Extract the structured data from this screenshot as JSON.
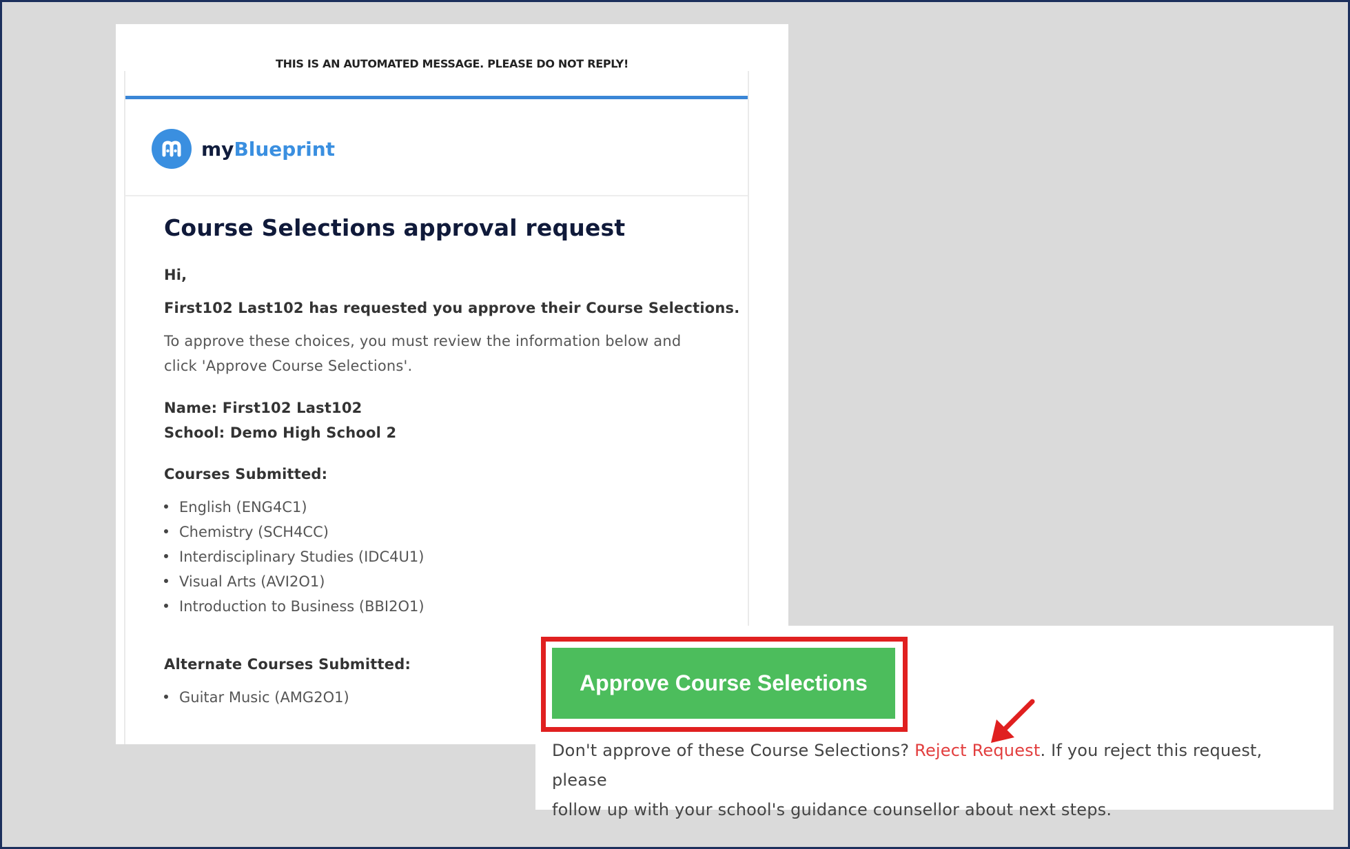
{
  "email": {
    "automated_note": "THIS IS AN AUTOMATED MESSAGE. PLEASE DO NOT REPLY!",
    "brand": {
      "prefix": "my",
      "name": "Blueprint",
      "accent": "#3a8fe0",
      "logo_icon": "myblueprint-logo-icon"
    },
    "heading": "Course Selections approval request",
    "greeting": "Hi,",
    "request_line": "First102 Last102 has requested you approve their Course Selections.",
    "instructions_line1": "To approve these choices, you must review the information below and",
    "instructions_line2": "click 'Approve Course Selections'.",
    "name_line": "Name: First102 Last102",
    "school_line": "School: Demo High School 2",
    "courses_heading": "Courses Submitted:",
    "courses": [
      "English (ENG4C1)",
      "Chemistry (SCH4CC)",
      "Interdisciplinary Studies (IDC4U1)",
      "Visual Arts (AVI2O1)",
      "Introduction to Business (BBI2O1)"
    ],
    "alternates_heading": "Alternate Courses Submitted:",
    "alternates": [
      "Guitar Music (AMG2O1)"
    ]
  },
  "overlay": {
    "approve_button": "Approve Course Selections",
    "approve_color": "#4cbd5c",
    "highlight_color": "#e02020",
    "reject_prefix": "Don't approve of these Course Selections? ",
    "reject_link": "Reject Request",
    "reject_suffix_line1": ". If you reject this request, please",
    "reject_suffix_line2": "follow up with your school's guidance counsellor about next steps.",
    "reject_link_color": "#e23e3e",
    "arrow_icon": "red-arrow-icon"
  }
}
